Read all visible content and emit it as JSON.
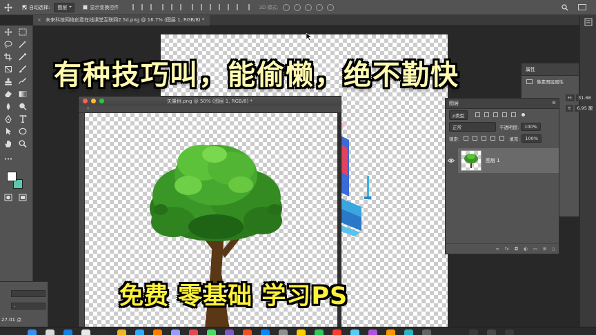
{
  "options_bar": {
    "auto_select_label": "自动选择:",
    "auto_select_checked": true,
    "auto_select_target": "图层",
    "show_transform_label": "显示变换控件",
    "show_transform_checked": false,
    "mode_3d_label": "3D 模式:"
  },
  "document_tab": {
    "close_glyph": "×",
    "title": "未来科技网络创意在线课堂互联网2.5d.png @ 16.7% (图层 1, RGB/8) *"
  },
  "floating_window": {
    "title": "矢量树.png @ 50% (图层 1, RGB/8) *",
    "ruler_origin": "0"
  },
  "properties_panel": {
    "title": "属性",
    "section_label": "像素图层属性",
    "h_label": "H:",
    "h_value": "31.68",
    "y_label": "Y:",
    "y_value": "6.95 厘"
  },
  "layers_panel": {
    "title": "图层",
    "filter_kind": "ρ类型",
    "blend_mode": "正常",
    "opacity_label": "不透明度:",
    "opacity_value": "100%",
    "lock_label": "锁定:",
    "fill_label": "填充:",
    "fill_value": "100%",
    "layers": [
      {
        "name": "图层 1",
        "visible": true,
        "selected": true
      }
    ],
    "footer_fx": "fx"
  },
  "left_panel": {
    "field_1": "",
    "field_2": "-",
    "font_size": "27.01 点"
  },
  "overlay": {
    "top_caption": "有种技巧叫，能偷懒，绝不勤快",
    "bottom_caption": "免费 零基础 学习PS"
  },
  "colors": {
    "foreground": "#ffffff",
    "background": "#5bc8b0",
    "ui_panel": "#535353",
    "workspace": "#282828",
    "caption_top": "#fffab0",
    "caption_bottom": "#fff23a"
  },
  "icons": [
    "move-tool-icon",
    "marquee-tool-icon",
    "lasso-tool-icon",
    "magic-wand-icon",
    "crop-tool-icon",
    "eyedropper-icon",
    "healing-brush-icon",
    "brush-tool-icon",
    "clone-stamp-icon",
    "history-brush-icon",
    "eraser-icon",
    "gradient-icon",
    "blur-tool-icon",
    "dodge-tool-icon",
    "pen-tool-icon",
    "type-tool-icon",
    "path-select-icon",
    "shape-tool-icon",
    "hand-tool-icon",
    "zoom-tool-icon"
  ]
}
